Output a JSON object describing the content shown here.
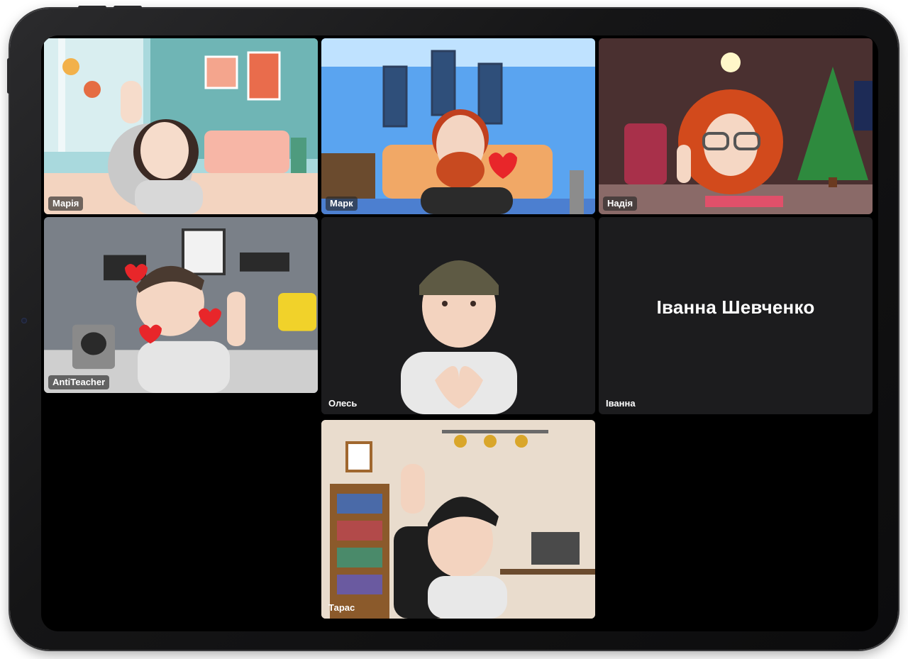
{
  "participants": [
    {
      "label": "Марія"
    },
    {
      "label": "Марк"
    },
    {
      "label": "Надія"
    },
    {
      "label": "AntiTeacher"
    },
    {
      "label": "Олесь"
    },
    {
      "label": "Іванна",
      "display_name": "Іванна Шевченко"
    },
    {
      "label": "Тарас"
    }
  ],
  "colors": {
    "screen_bg": "#000000",
    "tile_dark_bg": "#1c1c1e",
    "label_bg": "rgba(40,40,40,0.65)"
  }
}
